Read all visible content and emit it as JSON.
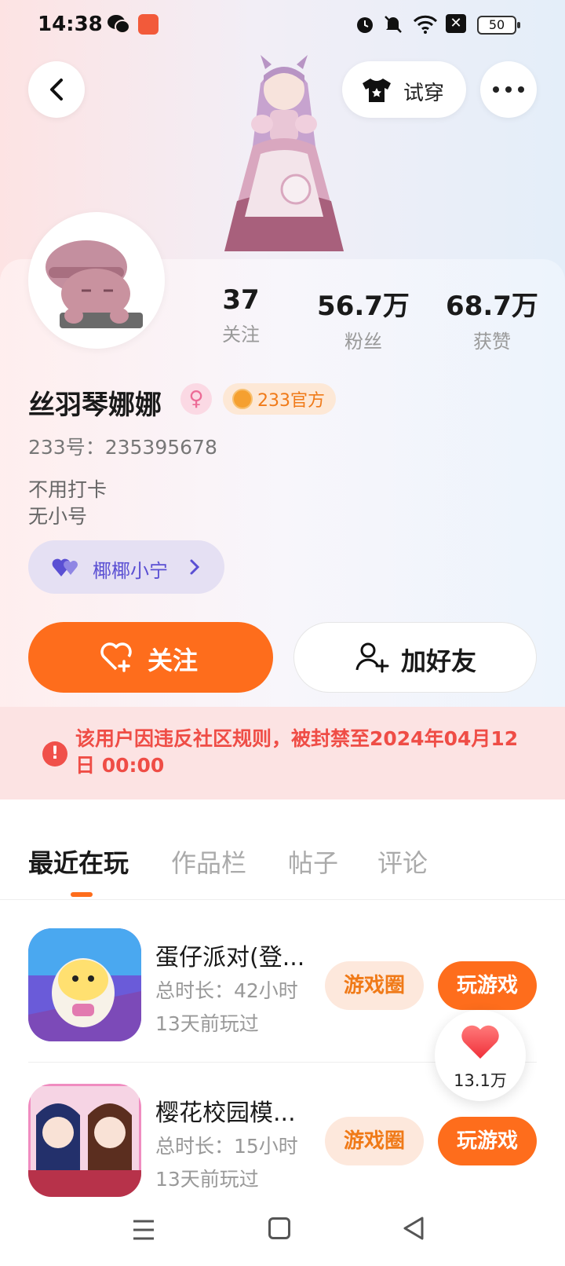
{
  "status_bar": {
    "time": "14:38",
    "battery": "50",
    "icons": [
      "wechat-icon",
      "app-icon",
      "alarm-icon",
      "mute-icon",
      "wifi-icon",
      "x-icon",
      "battery-icon"
    ]
  },
  "header": {
    "try_on_label": "试穿"
  },
  "profile": {
    "stats": [
      {
        "value": "37",
        "label": "关注"
      },
      {
        "value": "56.7万",
        "label": "粉丝"
      },
      {
        "value": "68.7万",
        "label": "获赞"
      }
    ],
    "username": "丝羽琴娜娜",
    "gender_symbol": "♀",
    "official_badge": "233官方",
    "user_id": "233号：235395678",
    "bio": [
      "不用打卡",
      "无小号"
    ],
    "cp_chip_label": "椰椰小宁"
  },
  "actions": {
    "follow_label": "关注",
    "add_friend_label": "加好友"
  },
  "ban_notice": {
    "icon": "!",
    "text": "该用户因违反社区规则，被封禁至2024年04月12日 00:00"
  },
  "tabs": [
    {
      "label": "最近在玩",
      "active": true
    },
    {
      "label": "作品栏",
      "active": false
    },
    {
      "label": "帖子",
      "active": false
    },
    {
      "label": "评论",
      "active": false
    }
  ],
  "games": [
    {
      "name": "蛋仔派对(登...",
      "duration": "总时长：42小时",
      "last_played": "13天前玩过",
      "circle_label": "游戏圈",
      "play_label": "玩游戏"
    },
    {
      "name": "樱花校园模...",
      "duration": "总时长：15小时",
      "last_played": "13天前玩过",
      "circle_label": "游戏圈",
      "play_label": "玩游戏"
    }
  ],
  "like_float": {
    "count": "13.1万"
  },
  "colors": {
    "accent": "#fe6d1c",
    "ban_text": "#ef4d46",
    "cp_text": "#5a4fd3"
  }
}
